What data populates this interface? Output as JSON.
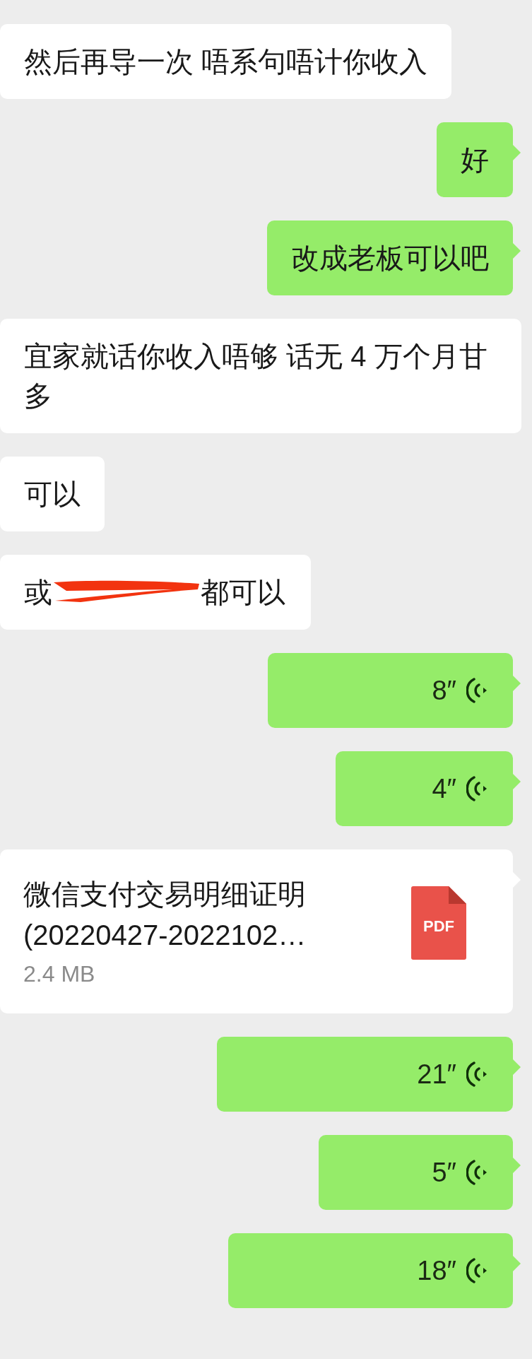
{
  "messages": [
    {
      "kind": "text",
      "outgoing": false,
      "text": "然后再导一次 唔系句唔计你收入"
    },
    {
      "kind": "text",
      "outgoing": true,
      "text": "好"
    },
    {
      "kind": "text",
      "outgoing": true,
      "text": "改成老板可以吧"
    },
    {
      "kind": "text",
      "outgoing": false,
      "text": "宜家就话你收入唔够 话无 4 万个月甘多"
    },
    {
      "kind": "text",
      "outgoing": false,
      "text": "可以"
    },
    {
      "kind": "redacted",
      "outgoing": false,
      "text_before": "或",
      "text_after": "都可以"
    },
    {
      "kind": "voice",
      "outgoing": true,
      "duration": "8″"
    },
    {
      "kind": "voice",
      "outgoing": true,
      "duration": "4″"
    },
    {
      "kind": "file",
      "outgoing": true,
      "file_name": "微信支付交易明细证明(20220427-2022102…",
      "file_size": "2.4 MB",
      "file_type": "PDF"
    },
    {
      "kind": "voice",
      "outgoing": true,
      "duration": "21″"
    },
    {
      "kind": "voice",
      "outgoing": true,
      "duration": "5″"
    },
    {
      "kind": "voice",
      "outgoing": true,
      "duration": "18″"
    }
  ]
}
